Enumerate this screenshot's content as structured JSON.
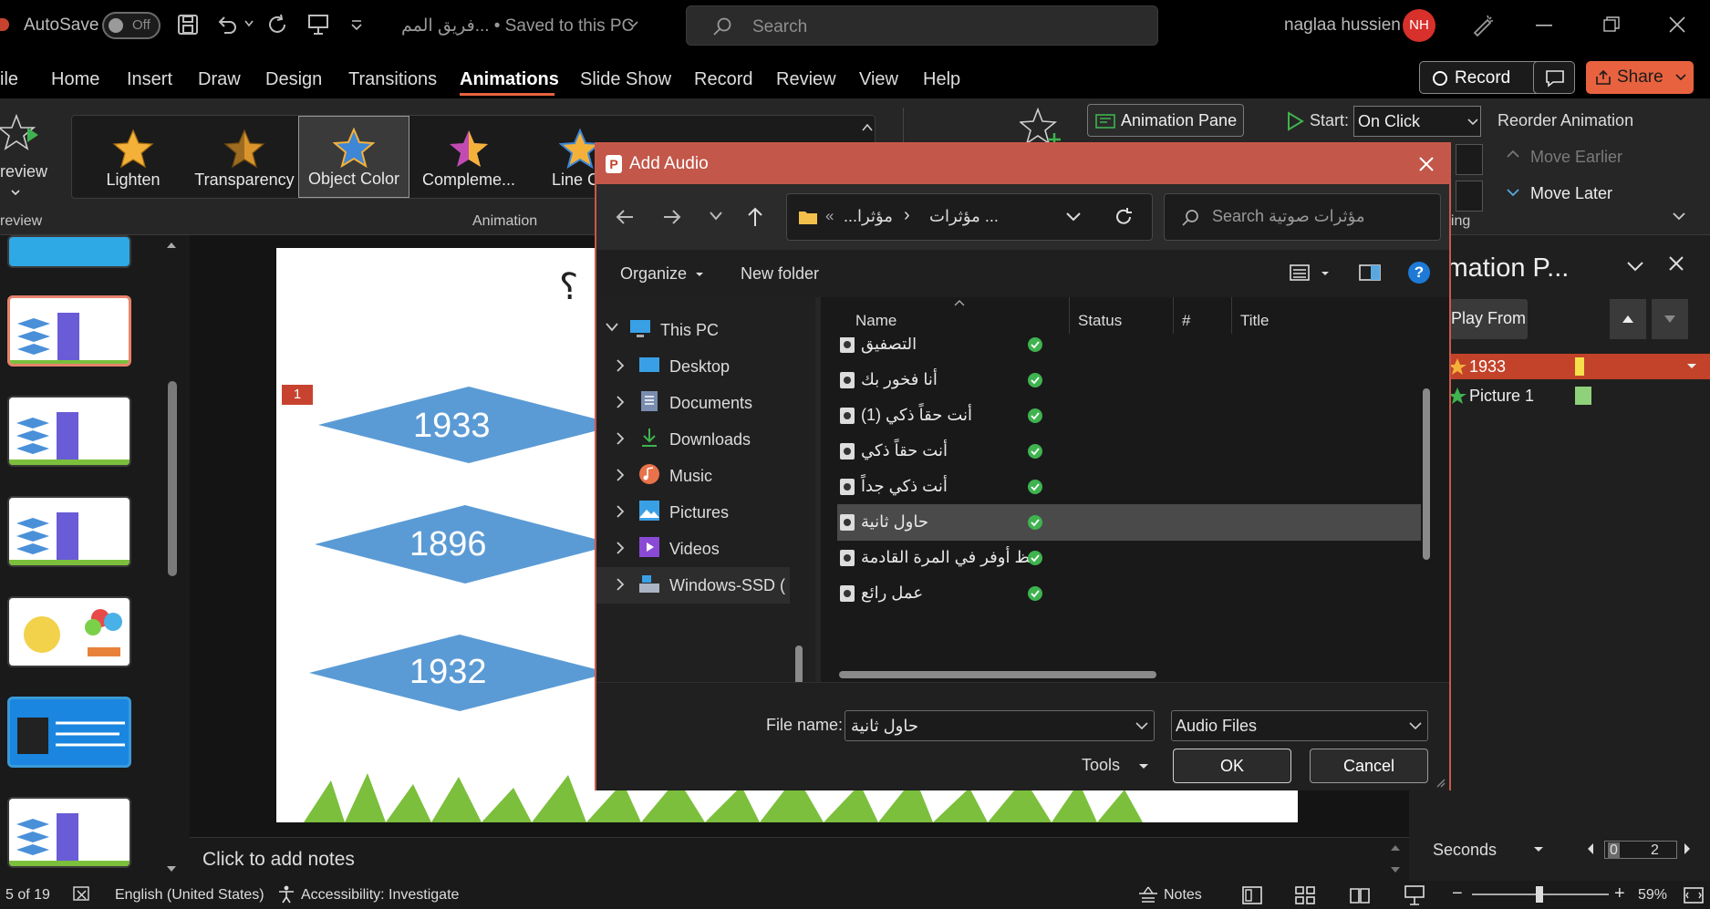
{
  "title_bar": {
    "autosave_label": "AutoSave",
    "autosave_state": "Off",
    "file_name": "فريق المم... • Saved to this PC",
    "search_placeholder": "Search",
    "user_name": "naglaa hussien",
    "user_initials": "NH"
  },
  "menu": {
    "items": [
      "ile",
      "Home",
      "Insert",
      "Draw",
      "Design",
      "Transitions",
      "Animations",
      "Slide Show",
      "Record",
      "Review",
      "View",
      "Help"
    ],
    "active": "Animations",
    "record_label": "Record",
    "share_label": "Share"
  },
  "ribbon": {
    "preview_label": "review",
    "preview_group": "review",
    "animation_group": "Animation",
    "timing_group": "ning",
    "gallery": [
      {
        "label": "Lighten",
        "color": "#f4b13a"
      },
      {
        "label": "Transparency",
        "color": "#d9952c"
      },
      {
        "label": "Object Color",
        "color": "#3e86d6"
      },
      {
        "label": "Compleme...",
        "color": "#c14bb3"
      },
      {
        "label": "Line Co",
        "color": "#f4b13a"
      }
    ],
    "animation_pane_label": "Animation Pane",
    "start_label": "Start:",
    "start_value": "On Click",
    "reorder_label": "Reorder Animation",
    "move_earlier": "Move Earlier",
    "move_later": "Move Later"
  },
  "slide": {
    "badge": "1",
    "question_mark": "؟",
    "diamonds": [
      "1933",
      "1896",
      "1932"
    ],
    "notes_placeholder": "Click to add notes"
  },
  "animation_pane": {
    "title": "imation P...",
    "play_from": "Play From",
    "items": [
      {
        "label": "1933",
        "selected": true,
        "bar_color": "#f5e04a"
      },
      {
        "label": "Picture 1",
        "selected": false,
        "bar_color": "#8fd07a"
      }
    ],
    "seconds_label": "Seconds",
    "timeline_start": "0",
    "timeline_end": "2"
  },
  "status_bar": {
    "slide_counter": "5 of 19",
    "language": "English (United States)",
    "accessibility": "Accessibility: Investigate",
    "notes_label": "Notes",
    "zoom": "59%"
  },
  "dialog": {
    "title": "Add Audio",
    "address_crumb_1": "...مؤثرا",
    "address_crumb_2": "مؤثرات ...",
    "search_placeholder": "Search مؤثرات صوتية",
    "organize_label": "Organize",
    "new_folder_label": "New folder",
    "tree": [
      {
        "label": "This PC",
        "icon": "computer-icon",
        "expanded": true
      },
      {
        "label": "Desktop",
        "icon": "desktop-icon"
      },
      {
        "label": "Documents",
        "icon": "documents-icon"
      },
      {
        "label": "Downloads",
        "icon": "downloads-icon"
      },
      {
        "label": "Music",
        "icon": "music-icon"
      },
      {
        "label": "Pictures",
        "icon": "pictures-icon"
      },
      {
        "label": "Videos",
        "icon": "videos-icon"
      },
      {
        "label": "Windows-SSD (",
        "icon": "drive-icon"
      }
    ],
    "columns": {
      "name": "Name",
      "status": "Status",
      "number": "#",
      "title": "Title"
    },
    "files": [
      {
        "name": "التصفيق",
        "selected": false
      },
      {
        "name": "أنا فخور بك",
        "selected": false
      },
      {
        "name": "أنت حقاً ذكي (1)",
        "selected": false
      },
      {
        "name": "أنت حقاً ذكي",
        "selected": false
      },
      {
        "name": "أنت ذكي جداً",
        "selected": false
      },
      {
        "name": "حاول ثانية",
        "selected": true
      },
      {
        "name": "حظ أوفر في المرة القادمة",
        "selected": false
      },
      {
        "name": "عمل رائع",
        "selected": false
      }
    ],
    "file_name_label": "File name:",
    "file_name_value": "حاول ثانية",
    "file_type_value": "Audio Files",
    "tools_label": "Tools",
    "ok_label": "OK",
    "cancel_label": "Cancel"
  }
}
